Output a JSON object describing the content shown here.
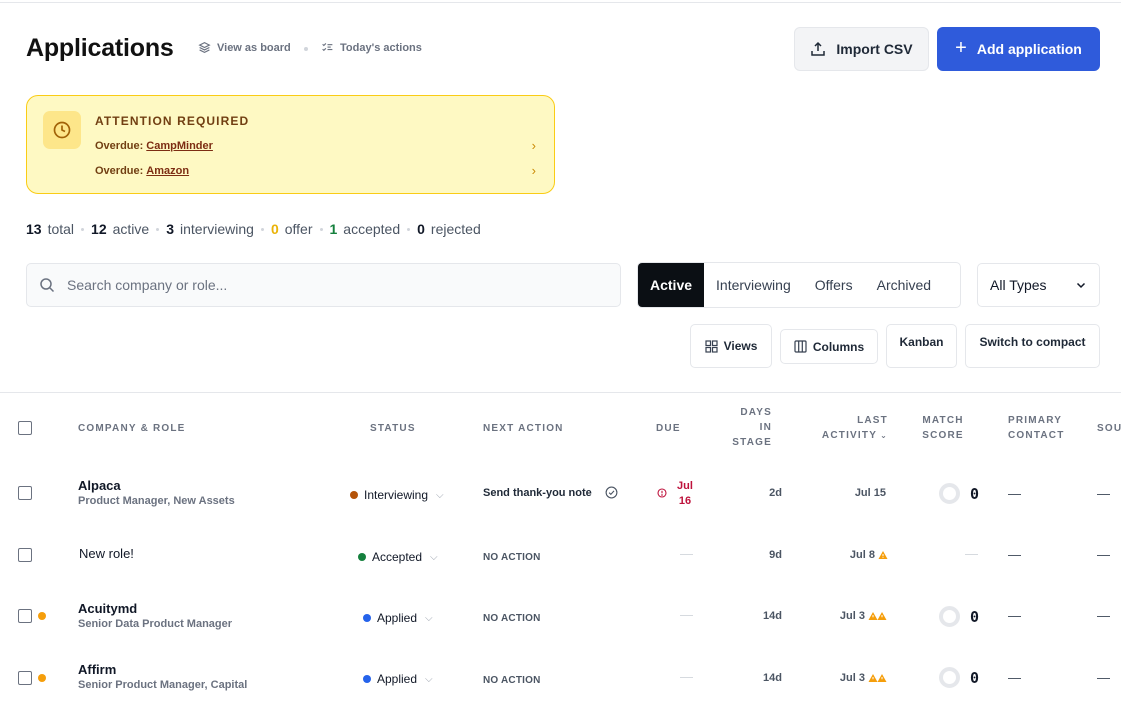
{
  "header": {
    "title": "Applications",
    "view_board": "View as board",
    "todays_actions": "Today's actions",
    "import_csv": "Import CSV",
    "add_application": "Add application"
  },
  "attention": {
    "title": "ATTENTION REQUIRED",
    "items": [
      {
        "prefix": "Overdue:",
        "company": "CampMinder"
      },
      {
        "prefix": "Overdue:",
        "company": "Amazon"
      }
    ]
  },
  "stats": [
    {
      "num": "13",
      "label": "total"
    },
    {
      "num": "12",
      "label": "active"
    },
    {
      "num": "3",
      "label": "interviewing"
    },
    {
      "num": "0",
      "label": "offer"
    },
    {
      "num": "1",
      "label": "accepted"
    },
    {
      "num": "0",
      "label": "rejected"
    }
  ],
  "search": {
    "placeholder": "Search company or role..."
  },
  "tabs": [
    "Active",
    "Interviewing",
    "Offers",
    "Archived"
  ],
  "type_filter": {
    "selected": "All Types"
  },
  "toolbar": {
    "views": "Views",
    "columns": "Columns",
    "kanban": "Kanban",
    "compact": "Switch to compact"
  },
  "table": {
    "headers": {
      "company_role": "COMPANY & ROLE",
      "status": "STATUS",
      "next_action": "NEXT ACTION",
      "due": "DUE",
      "days_line1": "DAYS",
      "days_line2": "IN",
      "days_line3": "STAGE",
      "last_line1": "LAST",
      "last_line2": "ACTIVITY",
      "match_line1": "MATCH",
      "match_line2": "SCORE",
      "contact_line1": "PRIMARY",
      "contact_line2": "CONTACT",
      "source": "SOU"
    },
    "rows": [
      {
        "company": "Alpaca",
        "role": "Product Manager, New Assets",
        "status": "Interviewing",
        "next_action": "Send thank-you note",
        "due_line1": "Jul",
        "due_line2": "16",
        "days": "2d",
        "last_activity": "Jul 15",
        "score": "0",
        "contact": "—",
        "source": "—"
      },
      {
        "company": "New role!",
        "role": "",
        "status": "Accepted",
        "next_action": "NO ACTION",
        "due": "—",
        "days": "9d",
        "last_activity": "Jul 8",
        "score": "—",
        "contact": "—",
        "source": "—"
      },
      {
        "company": "Acuitymd",
        "role": "Senior Data Product Manager",
        "status": "Applied",
        "next_action": "NO ACTION",
        "due": "—",
        "days": "14d",
        "last_activity": "Jul 3",
        "score": "0",
        "contact": "—",
        "source": "—"
      },
      {
        "company": "Affirm",
        "role": "Senior Product Manager, Capital",
        "status": "Applied",
        "next_action": "NO ACTION",
        "due": "—",
        "days": "14d",
        "last_activity": "Jul 3",
        "score": "0",
        "contact": "—",
        "source": "—"
      }
    ]
  },
  "colors": {
    "accent": "#2f5bdb",
    "interviewing": "#b45309",
    "accepted": "#15803d",
    "applied": "#2563eb",
    "warning": "#f59e0b",
    "overdue": "#be123c"
  }
}
